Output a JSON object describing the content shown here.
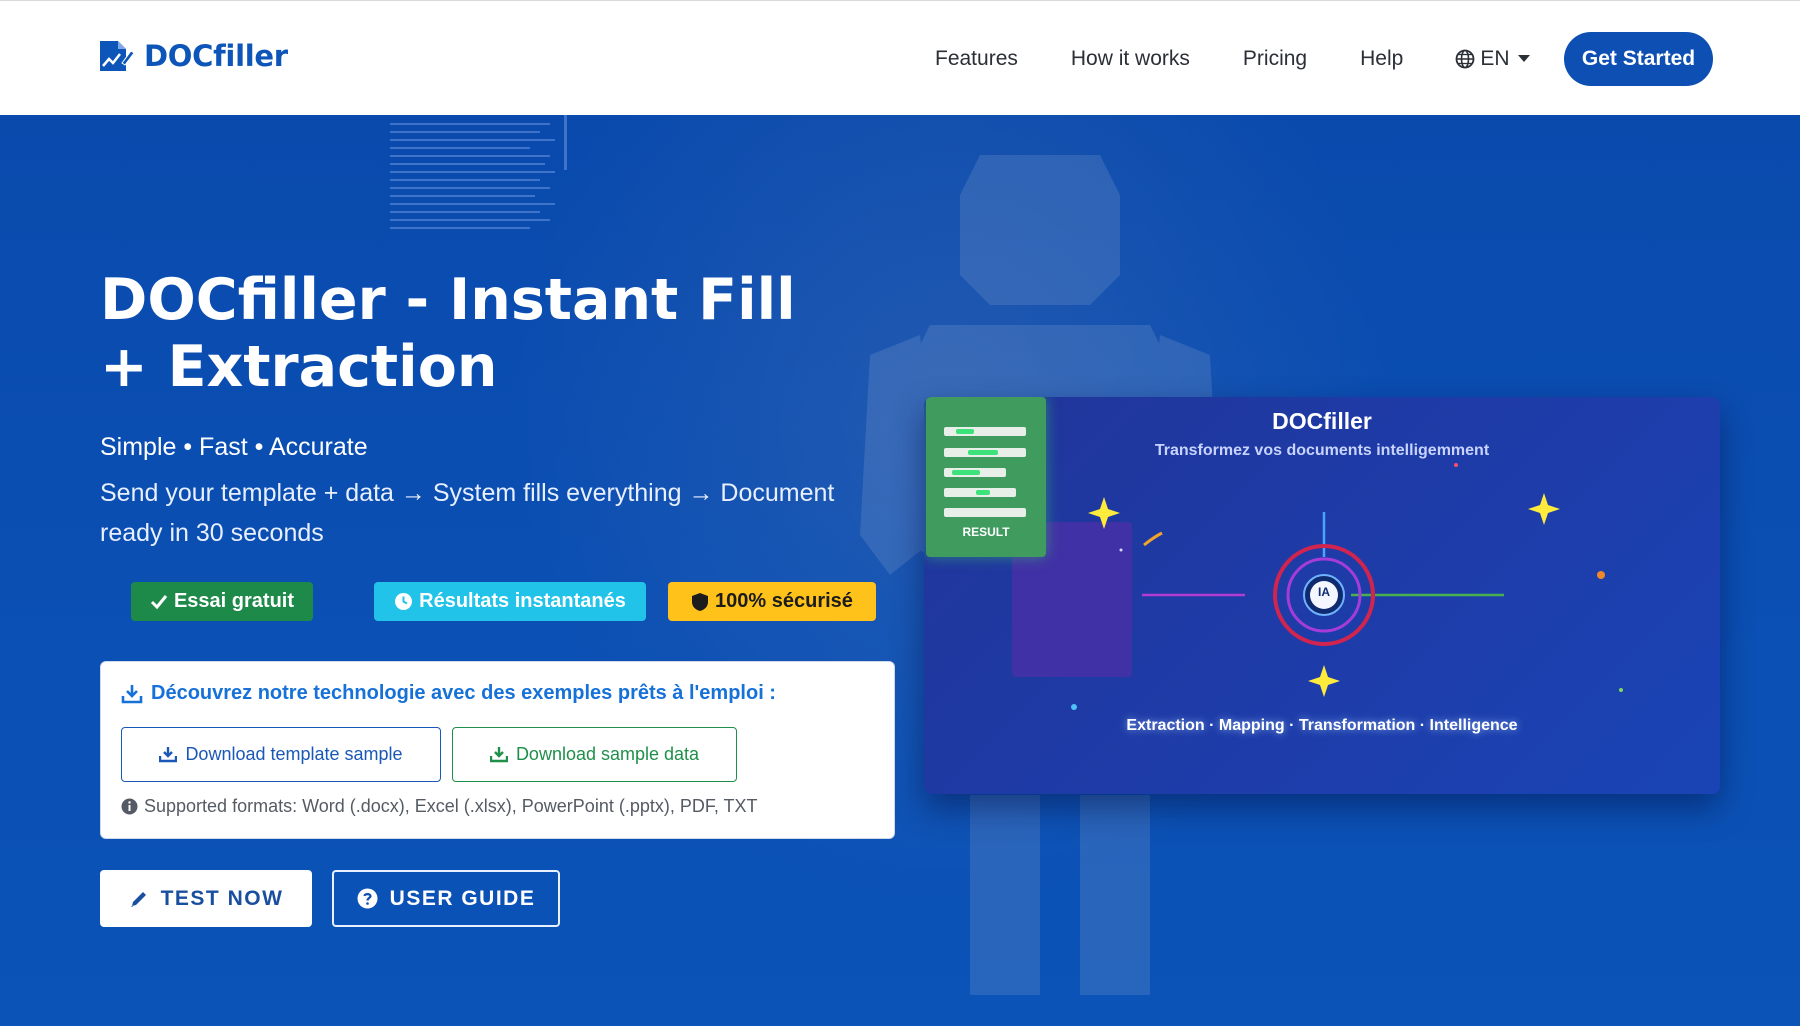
{
  "brand": {
    "name": "DOCfiller",
    "icon": "document-chart-icon"
  },
  "nav": {
    "links": [
      "Features",
      "How it works",
      "Pricing",
      "Help"
    ],
    "language": "EN",
    "cta": "Get Started"
  },
  "hero": {
    "title": "DOCfiller - Instant Fill + Extraction",
    "tagline": "Simple • Fast • Accurate",
    "description": "Send your template + data → System fills everything → Document ready in 30 seconds",
    "badges": [
      {
        "label": "Essai gratuit",
        "icon": "check-icon",
        "color": "#1e8a4a"
      },
      {
        "label": "Résultats instantanés",
        "icon": "clock-icon",
        "color": "#22c3e8"
      },
      {
        "label": "100% sécurisé",
        "icon": "shield-icon",
        "color": "#ffc21a"
      }
    ],
    "samples": {
      "title": "Découvrez notre technologie avec des exemples prêts à l'emploi :",
      "template_button": "Download template sample",
      "data_button": "Download sample data",
      "formats": "Supported formats: Word (.docx), Excel (.xlsx), PowerPoint (.pptx), PDF, TXT"
    },
    "primary_button": "TEST NOW",
    "secondary_button": "USER GUIDE"
  },
  "illustration": {
    "title": "DOCfiller",
    "subtitle": "Transformez vos documents intelligemment",
    "result_label": "RESULT",
    "hub_label": "IA",
    "footer": "Extraction · Mapping · Transformation · Intelligence"
  },
  "colors": {
    "primary": "#0d4fb3",
    "hero_bg": "#0b4db0",
    "accent_green": "#1e8a4a",
    "accent_cyan": "#22c3e8",
    "accent_yellow": "#ffc21a"
  }
}
